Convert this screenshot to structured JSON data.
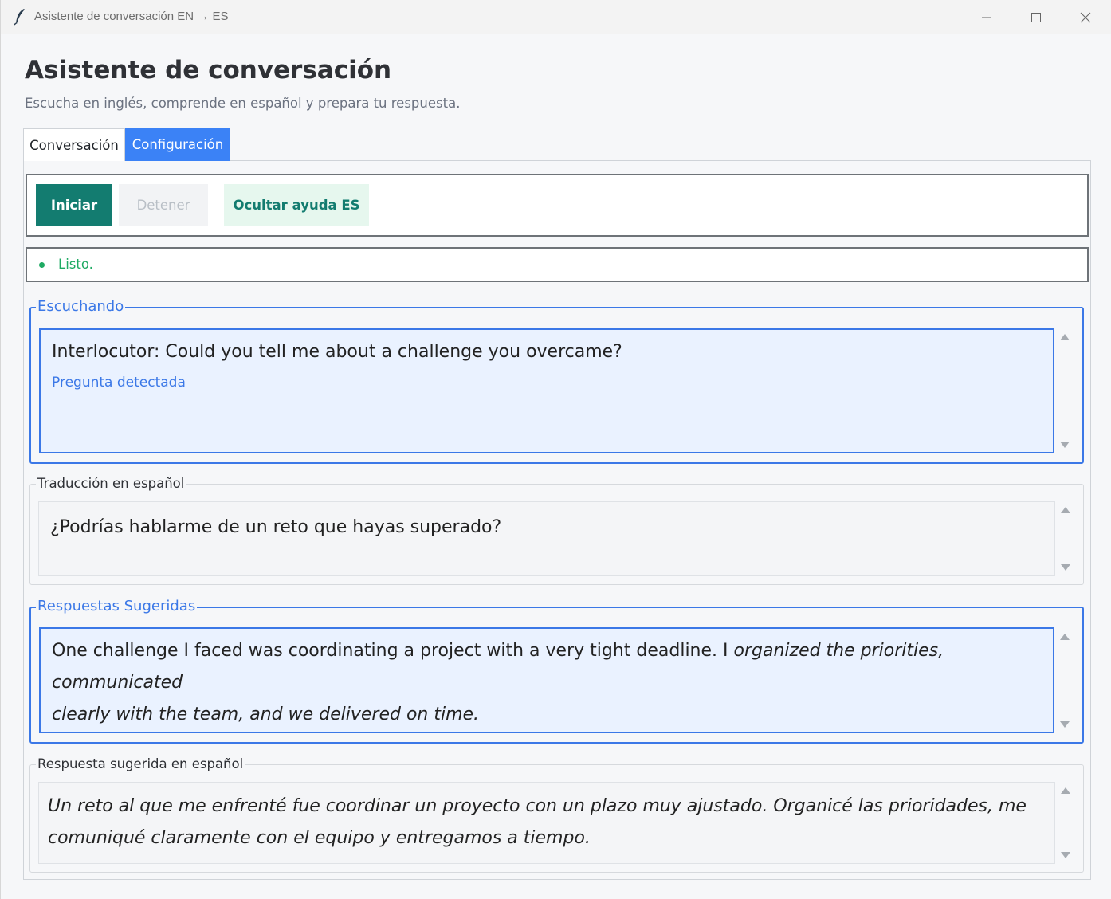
{
  "window": {
    "title": "Asistente de conversación EN → ES",
    "icon": "feather-icon",
    "controls": [
      "minimize-icon",
      "maximize-icon",
      "close-icon"
    ]
  },
  "header": {
    "title": "Asistente de conversación",
    "subtitle": "Escucha en inglés, comprende en español y prepara tu respuesta."
  },
  "tabs": [
    {
      "label": "Conversación",
      "active": false
    },
    {
      "label": "Configuración",
      "active": true
    }
  ],
  "toolbar": {
    "start_label": "Iniciar",
    "stop_label": "Detener",
    "help_label": "Ocultar ayuda ES"
  },
  "status": {
    "text": "Listo.",
    "color": "#1faa63"
  },
  "sections": {
    "listening": {
      "legend": "Escuchando",
      "text": "Interlocutor: Could you tell me about a challenge you overcame?",
      "note": "Pregunta detectada"
    },
    "translation": {
      "legend": "Traducción en español",
      "text": "¿Podrías hablarme de un reto que hayas superado?"
    },
    "suggested": {
      "legend": "Respuestas Sugeridas",
      "text_plain": "One challenge I faced was coordinating a project with a very tight deadline. I",
      "text_italic_1": " organized the priorities, communicated",
      "text_italic_2": "clearly with the team, and we delivered on time."
    },
    "suggested_es": {
      "legend": "Respuesta sugerida en español",
      "line1": "Un reto al que me enfrenté fue coordinar un proyecto con un plazo muy ajustado. Organicé las prioridades, me",
      "line2": "comuniqué claramente con el equipo y entregamos a tiempo."
    }
  },
  "colors": {
    "accent": "#3b82f6",
    "primary_button": "#137c70",
    "active_frame": "#3b78e7"
  }
}
